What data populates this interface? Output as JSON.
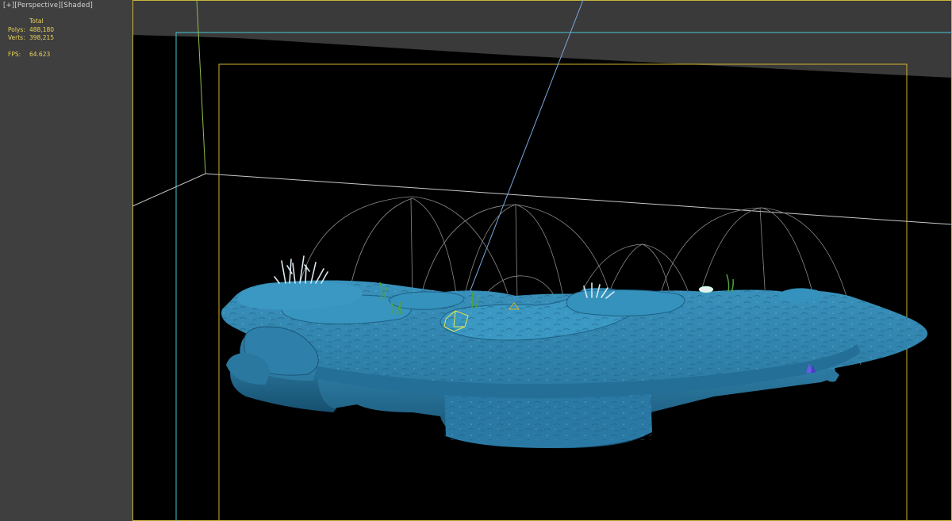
{
  "viewport": {
    "menu_plus": "[+]",
    "view_mode": "[Perspective]",
    "shading_mode": "[Shaded]"
  },
  "stats": {
    "header": "Total",
    "polys_label": "Polys:",
    "polys_value": "488,180",
    "verts_label": "Verts:",
    "verts_value": "398,215",
    "fps_label": "FPS:",
    "fps_value": "64.623"
  },
  "colors": {
    "viewport_bg": "#3f3f3f",
    "stats_text": "#e8d25a",
    "safe_frame_outer": "#c8b43a",
    "safe_frame_live": "#46c6d2",
    "safe_frame_action": "#d2b22e",
    "terrain_main": "#2c7ea8",
    "grid_lines": "#9a9a9a"
  },
  "icons": [
    "camera-target-icon",
    "light-helper-icon"
  ]
}
